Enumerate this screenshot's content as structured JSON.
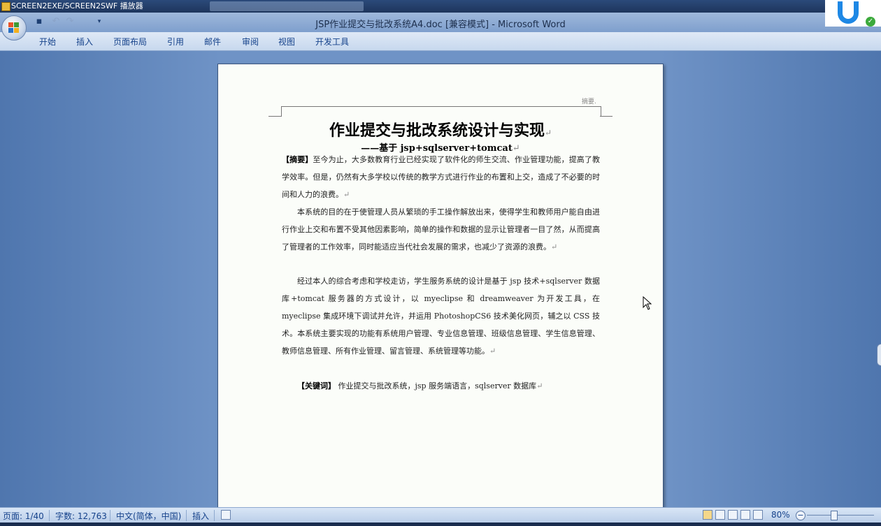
{
  "player": {
    "title": "SCREEN2EXE/SCREEN2SWF 播放器"
  },
  "window": {
    "title": "JSP作业提交与批改系统A4.doc [兼容模式] - Microsoft Word"
  },
  "ribbon": {
    "tabs": [
      "开始",
      "插入",
      "页面布局",
      "引用",
      "邮件",
      "审阅",
      "视图",
      "开发工具"
    ]
  },
  "document": {
    "comment_label": "摘要.",
    "heading": "作业提交与批改系统设计与实现",
    "subheading": "——基于 jsp+sqlserver+tomcat",
    "abstract_label": "【摘要】",
    "paragraph1": "至今为止，大多数教育行业已经实现了软件化的师生交流、作业管理功能，提高了教学效率。但是，仍然有大多学校以传统的教学方式进行作业的布置和上交，造成了不必要的时间和人力的浪费。",
    "paragraph2": "本系统的目的在于使管理人员从繁琐的手工操作解放出来，使得学生和教师用户能自由进行作业上交和布置不受其他因素影响，简单的操作和数据的显示让管理者一目了然，从而提高了管理者的工作效率，同时能适应当代社会发展的需求，也减少了资源的浪费。",
    "paragraph3": "经过本人的综合考虑和学校走访，学生服务系统的设计是基于 jsp 技术+sqlserver 数据库+tomcat 服务器的方式设计，以 myeclipse 和 dreamweaver 为开发工具，在 myeclipse 集成环境下调试并允许，并运用 PhotoshopCS6 技术美化网页，辅之以 CSS 技术。本系统主要实现的功能有系统用户管理、专业信息管理、班级信息管理、学生信息管理、教师信息管理、所有作业管理、留言管理、系统管理等功能。",
    "keywords_label": "【关键词】",
    "keywords": " 作业提交与批改系统，jsp 服务端语言，sqlserver 数据库",
    "paragraph_mark": "↵"
  },
  "status": {
    "page": "页面: 1/40",
    "words": "字数: 12,763",
    "language": "中文(简体，中国)",
    "mode": "插入",
    "zoom": "80%",
    "zoom_minus": "−",
    "zoom_plus": "+"
  },
  "colors": {
    "ribbon_text": "#15428b",
    "office_logo": [
      "#e8542a",
      "#3f9a35",
      "#2a72c6",
      "#f2b01e"
    ]
  }
}
